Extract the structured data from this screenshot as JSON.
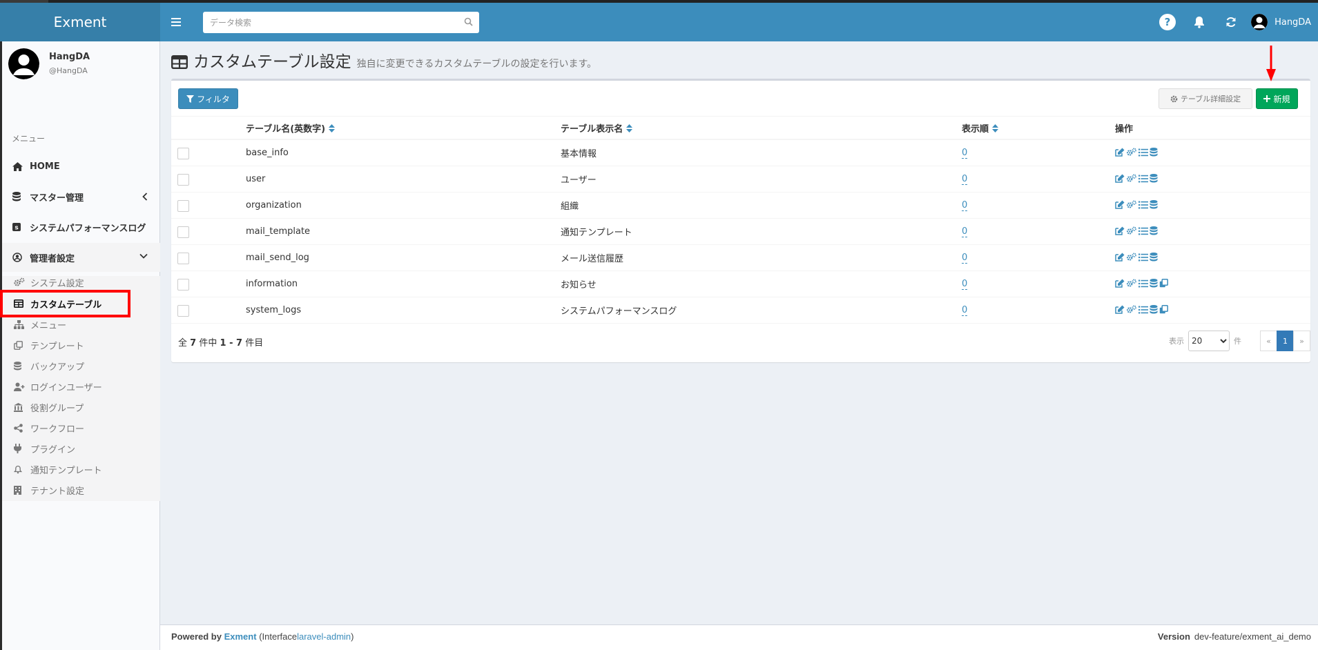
{
  "header": {
    "logo": "Exment",
    "search_placeholder": "データ検索",
    "user_name": "HangDA"
  },
  "sidebar": {
    "user": {
      "name": "HangDA",
      "id": "@HangDA"
    },
    "menu_header": "メニュー",
    "items": [
      {
        "label": "HOME",
        "icon": "home-icon"
      },
      {
        "label": "マスター管理",
        "icon": "database-icon"
      },
      {
        "label": "システムパフォーマンスログ",
        "icon": "log-icon"
      },
      {
        "label": "管理者設定",
        "icon": "user-circle-icon"
      }
    ],
    "sub_items": [
      {
        "label": "システム設定",
        "icon": "gears-icon"
      },
      {
        "label": "カスタムテーブル",
        "icon": "table-icon"
      },
      {
        "label": "メニュー",
        "icon": "sitemap-icon"
      },
      {
        "label": "テンプレート",
        "icon": "copy-icon"
      },
      {
        "label": "バックアップ",
        "icon": "database-icon"
      },
      {
        "label": "ログインユーザー",
        "icon": "user-plus-icon"
      },
      {
        "label": "役割グループ",
        "icon": "bank-icon"
      },
      {
        "label": "ワークフロー",
        "icon": "share-icon"
      },
      {
        "label": "プラグイン",
        "icon": "plug-icon"
      },
      {
        "label": "通知テンプレート",
        "icon": "bell-icon"
      },
      {
        "label": "テナント設定",
        "icon": "building-icon"
      }
    ],
    "active_sub_item": "カスタムテーブル"
  },
  "page": {
    "title": "カスタムテーブル設定",
    "subtitle": "独自に変更できるカスタムテーブルの設定を行います。"
  },
  "toolbar": {
    "filter_label": "フィルタ",
    "detail_label": "テーブル詳細設定",
    "new_label": "新規"
  },
  "table": {
    "columns": [
      "テーブル名(英数字)",
      "テーブル表示名",
      "表示順",
      "操作"
    ],
    "rows": [
      {
        "name": "base_info",
        "display": "基本情報",
        "order": "0",
        "ops": [
          "edit-icon",
          "gears-icon",
          "list-icon",
          "database-icon"
        ]
      },
      {
        "name": "user",
        "display": "ユーザー",
        "order": "0",
        "ops": [
          "edit-icon",
          "gears-icon",
          "list-icon",
          "database-icon"
        ]
      },
      {
        "name": "organization",
        "display": "組織",
        "order": "0",
        "ops": [
          "edit-icon",
          "gears-icon",
          "list-icon",
          "database-icon"
        ]
      },
      {
        "name": "mail_template",
        "display": "通知テンプレート",
        "order": "0",
        "ops": [
          "edit-icon",
          "gears-icon",
          "list-icon",
          "database-icon"
        ]
      },
      {
        "name": "mail_send_log",
        "display": "メール送信履歴",
        "order": "0",
        "ops": [
          "edit-icon",
          "gears-icon",
          "list-icon",
          "database-icon"
        ]
      },
      {
        "name": "information",
        "display": "お知らせ",
        "order": "0",
        "ops": [
          "edit-icon",
          "gears-icon",
          "list-icon",
          "database-icon",
          "copy-icon"
        ]
      },
      {
        "name": "system_logs",
        "display": "システムパフォーマンスログ",
        "order": "0",
        "ops": [
          "edit-icon",
          "gears-icon",
          "list-icon",
          "database-icon",
          "copy-icon"
        ]
      }
    ]
  },
  "pagination": {
    "total_prefix": "全",
    "total_count": "7",
    "total_mid": "件中",
    "range": "1 - 7",
    "range_suffix": "件目",
    "per_page_label": "表示",
    "per_page_value": "20",
    "per_page_unit": "件",
    "prev": "«",
    "current": "1",
    "next": "»"
  },
  "footer": {
    "powered_by": "Powered by",
    "brand": "Exment",
    "interface_prefix": "(Interface",
    "interface_link": "laravel-admin",
    "interface_suffix": ")",
    "version_label": "Version",
    "version_value": "dev-feature/exment_ai_demo"
  },
  "colors": {
    "header": "#3c8dbc",
    "logo_bg": "#367fa9",
    "new_button": "#00a65a",
    "highlight": "#ff0000"
  }
}
